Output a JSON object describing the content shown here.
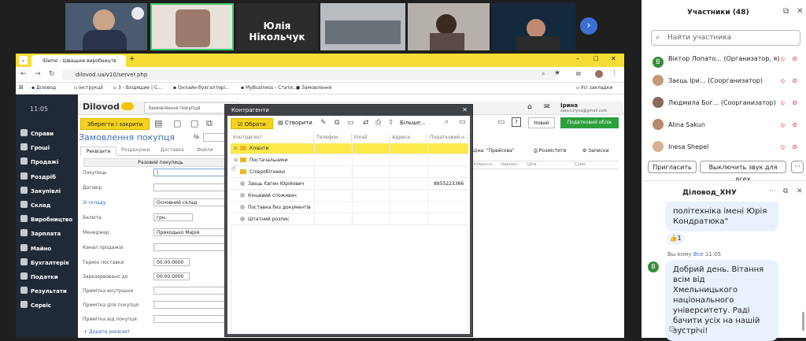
{
  "video": {
    "tiles": [
      {
        "label": ""
      },
      {
        "label": ""
      },
      {
        "label": "Юлія Нікольчук"
      },
      {
        "label": ""
      },
      {
        "label": ""
      },
      {
        "label": ""
      }
    ]
  },
  "browser": {
    "tab_title": "IDemo - Швацьке виробництв",
    "url": "dilovod.ua/v10/server.php",
    "bookmarks": [
      "Діловод",
      "Інструкції",
      "3 - Вхідящие | С...",
      "Онлайн-бухгалтері...",
      "MyBusiness - Стати...",
      "Замовлення"
    ],
    "all_bookmarks": "Усі закладки"
  },
  "app": {
    "time": "11:05",
    "logo": "Dilovod",
    "doc_tab": "Замовлення покупця",
    "nav": [
      "Справи",
      "Гроші",
      "Продажі",
      "Роздріб",
      "Закупівлі",
      "Склад",
      "Виробництво",
      "Зарплата",
      "Майно",
      "Бухгалтерія",
      "Податки",
      "Результати",
      "Сервіс"
    ],
    "save_close": "Зберегти і закрити",
    "doc_title": "Замовлення покупця",
    "num_label": "№",
    "subtabs": [
      "Реквізити",
      "Розрахунки",
      "Доставка",
      "Файли"
    ],
    "subheader": "Разовий покупець",
    "fields": [
      {
        "label": "Покупець",
        "value": "|"
      },
      {
        "label": "Договір",
        "value": ""
      },
      {
        "label": "Зі складу",
        "value": "Основний склад"
      },
      {
        "label": "Валюта",
        "value": "грн."
      },
      {
        "label": "Менеджер",
        "value": "Приходько Марія"
      },
      {
        "label": "Канал продажів",
        "value": ""
      },
      {
        "label": "Термін поставки",
        "value": "00.00.0000"
      },
      {
        "label": "Зарезервовано до",
        "value": "00.00.0000"
      },
      {
        "label": "Примітка внутрішня",
        "value": ""
      },
      {
        "label": "Примітка для покупця",
        "value": ""
      },
      {
        "label": "Примітка від покупця",
        "value": ""
      }
    ],
    "add_req": "+ Додати реквізит",
    "user_name": "Ірина",
    "user_email": "zaecz.iryna@gmail.com",
    "new_btn": "Новий",
    "tax_btn": "Податковий облік",
    "price_label": "Ціна: \"Прайсова\"",
    "place_btn": "Розмістити",
    "notes_btn": "Записки",
    "table_cols": [
      "Кількість",
      "Одиниці",
      "Ціна",
      "Сума"
    ]
  },
  "modal": {
    "title": "Контрагенти",
    "select_btn": "Обрати",
    "create_btn": "Створити",
    "more_btn": "Більше...",
    "cols": [
      "Контрагент",
      "Телефон",
      "Email",
      "Адреса",
      "Податковий н"
    ],
    "rows": [
      {
        "name": "Клієнти",
        "type": "folder",
        "phone": "",
        "selected": true
      },
      {
        "name": "Постачальники",
        "type": "folder",
        "phone": "",
        "selected": false
      },
      {
        "name": "Співробітники",
        "type": "folder",
        "phone": "",
        "selected": false
      },
      {
        "name": "Заєць Євген Юрійович",
        "type": "item",
        "phone": "8855223366",
        "selected": false
      },
      {
        "name": "Кінцевий споживач",
        "type": "item",
        "phone": "",
        "selected": false
      },
      {
        "name": "Поставка без документів",
        "type": "item",
        "phone": "",
        "selected": false
      },
      {
        "name": "Штатний розпис",
        "type": "item",
        "phone": "",
        "selected": false
      }
    ]
  },
  "participants": {
    "title": "Участники (48)",
    "search_placeholder": "Найти участника",
    "list": [
      {
        "initial": "В",
        "color": "#3a8e3a",
        "name": "Віктор Лопато...",
        "role": "(Организатор, я)"
      },
      {
        "initial": "",
        "color": "#c49a7a",
        "name": "Заєць Іри...",
        "role": "(Соорганизатор)"
      },
      {
        "initial": "",
        "color": "#8a6a5a",
        "name": "Людмила Бог...",
        "role": "(Соорганизатор)"
      },
      {
        "initial": "",
        "color": "#b58a6a",
        "name": "Alina Sakun",
        "role": ""
      },
      {
        "initial": "",
        "color": "#d8b090",
        "name": "Inesa Shepel",
        "role": ""
      }
    ],
    "invite_btn": "Пригласить",
    "mute_all_btn": "Выключить звук для всех",
    "more_btn": "···"
  },
  "chat": {
    "title": "Діловод_ХНУ",
    "prev_msg": "політехніка імені Юрія Кондратюка\"",
    "reaction": "1",
    "meta_you": "Вы кому",
    "meta_all": "Все",
    "meta_time": "11:05",
    "avatar": "В",
    "message": "Добрий день. Вітання всім від Хмельницького національного університету. Раді бачити усіх на нашій зустрічі!"
  }
}
